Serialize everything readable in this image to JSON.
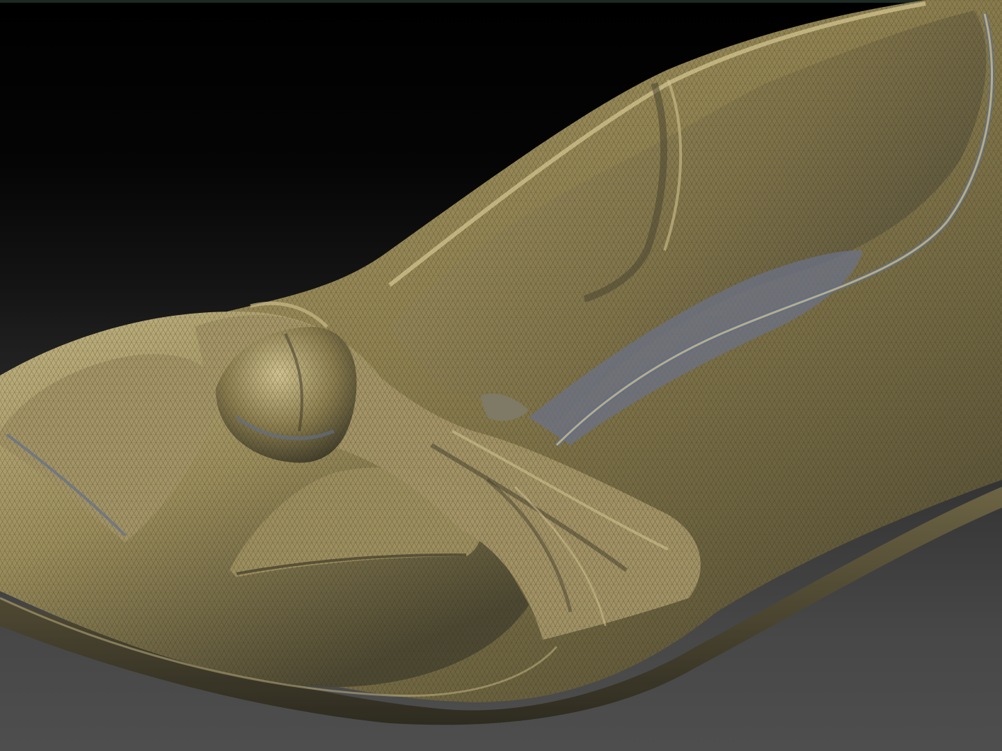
{
  "viewport": {
    "background_top": "#000000",
    "background_bottom": "#4e4e4e",
    "top_line_color": "#1d2a23"
  },
  "model": {
    "subject": "shoe-mesh-sculpt",
    "material_base": "#8d7f4e",
    "material_highlight": "#c8b986",
    "material_shadow": "#3c3a2a",
    "cavity_blue": "#5f6f8c",
    "wire_color": "#2a2818"
  }
}
